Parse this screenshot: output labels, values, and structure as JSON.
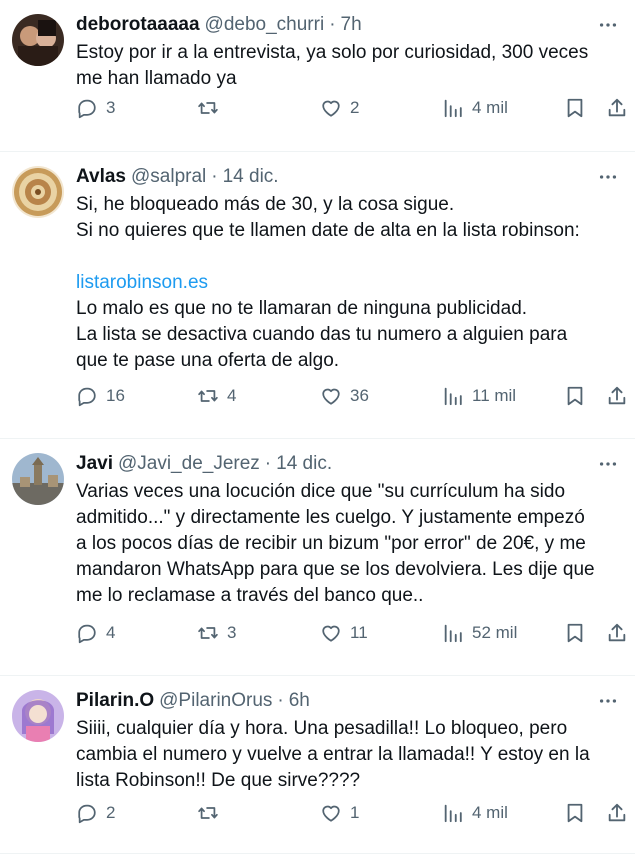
{
  "tweets": [
    {
      "name": "deborotaaaaa",
      "handle": "@debo_churri",
      "time": "7h",
      "lines": [
        {
          "text": "Estoy por ir a la entrevista, ya solo por curiosidad, 300 veces"
        },
        {
          "text": "me han llamado ya"
        }
      ],
      "replies": "3",
      "retweets": "",
      "likes": "2",
      "views": "4 mil"
    },
    {
      "name": "Avlas",
      "handle": "@salpral",
      "time": "14 dic.",
      "lines": [
        {
          "text": "Si, he bloqueado más de 30, y la cosa sigue."
        },
        {
          "text": "Si no quieres que te llamen date de alta en la lista robinson:"
        },
        {
          "text": ""
        },
        {
          "text": "listarobinson.es",
          "link": true
        },
        {
          "text": "Lo malo es que no te llamaran de ninguna publicidad."
        },
        {
          "text": "La lista se desactiva cuando das tu numero a alguien para"
        },
        {
          "text": "que te pase una oferta de algo."
        }
      ],
      "replies": "16",
      "retweets": "4",
      "likes": "36",
      "views": "11 mil"
    },
    {
      "name": "Javi",
      "handle": "@Javi_de_Jerez",
      "time": "14 dic.",
      "lines": [
        {
          "text": "Varias veces una locución dice que \"su currículum ha sido"
        },
        {
          "text": "admitido...\" y directamente les cuelgo. Y justamente empezó"
        },
        {
          "text": "a los pocos días de recibir un bizum \"por error\" de 20€, y me"
        },
        {
          "text": "mandaron WhatsApp para que se los devolviera. Les dije que"
        },
        {
          "text": "me lo reclamase a través del banco que.."
        }
      ],
      "replies": "4",
      "retweets": "3",
      "likes": "11",
      "views": "52 mil"
    },
    {
      "name": "Pilarin.O",
      "handle": "@PilarinOrus",
      "time": "6h",
      "lines": [
        {
          "text": "Siiii, cualquier día y hora. Una pesadilla!! Lo bloqueo, pero"
        },
        {
          "text": "cambia el numero y vuelve a entrar la llamada!! Y estoy en la"
        },
        {
          "text": "lista Robinson!! De que sirve????"
        }
      ],
      "replies": "2",
      "retweets": "",
      "likes": "1",
      "views": "4 mil"
    }
  ],
  "icons": {
    "reply": "reply-icon",
    "retweet": "retweet-icon",
    "like": "like-icon",
    "views": "views-icon",
    "bookmark": "bookmark-icon",
    "share": "share-icon",
    "more": "more-icon"
  },
  "colors": {
    "text": "#0f1419",
    "secondary": "#536471",
    "link": "#1d9bf0",
    "divider": "#eff3f4"
  }
}
